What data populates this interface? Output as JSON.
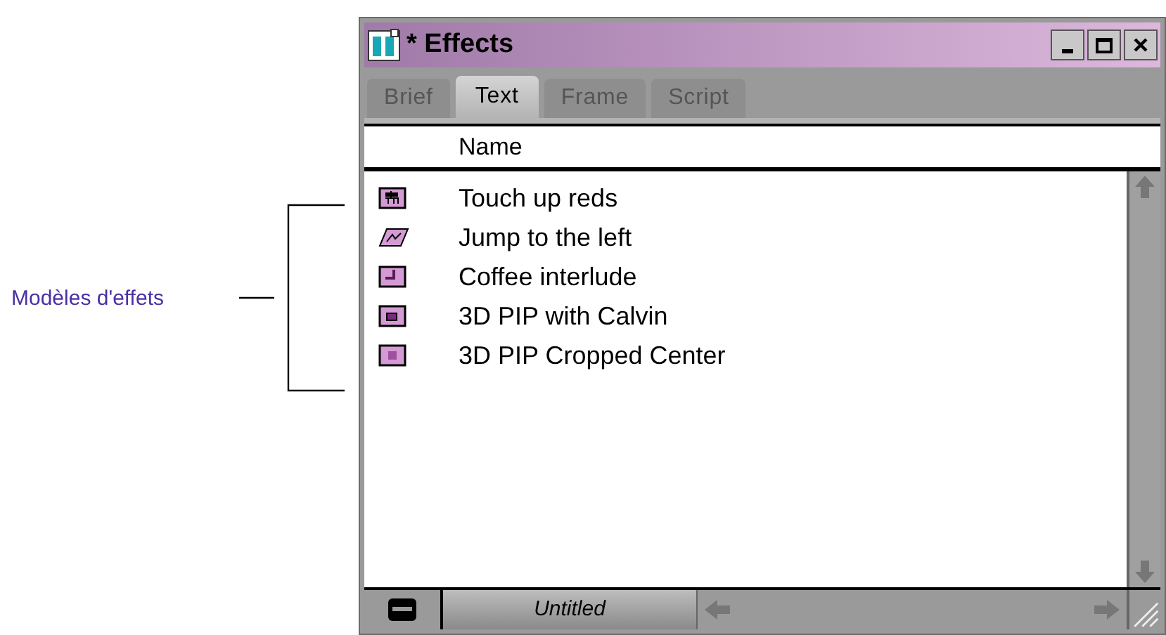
{
  "callout": {
    "label": "Modèles d'effets"
  },
  "window": {
    "title": "* Effects"
  },
  "tabs": [
    {
      "label": "Brief",
      "selected": false
    },
    {
      "label": "Text",
      "selected": true
    },
    {
      "label": "Frame",
      "selected": false
    },
    {
      "label": "Script",
      "selected": false
    }
  ],
  "list": {
    "columns": [
      "Name"
    ],
    "items": [
      {
        "name": "Touch up reds",
        "kind": "color"
      },
      {
        "name": "Jump to the left",
        "kind": "motion"
      },
      {
        "name": "Coffee interlude",
        "kind": "corner"
      },
      {
        "name": "3D PIP with Calvin",
        "kind": "pip"
      },
      {
        "name": "3D PIP Cropped Center",
        "kind": "center"
      }
    ]
  },
  "status_bar": {
    "bin": "Untitled"
  }
}
